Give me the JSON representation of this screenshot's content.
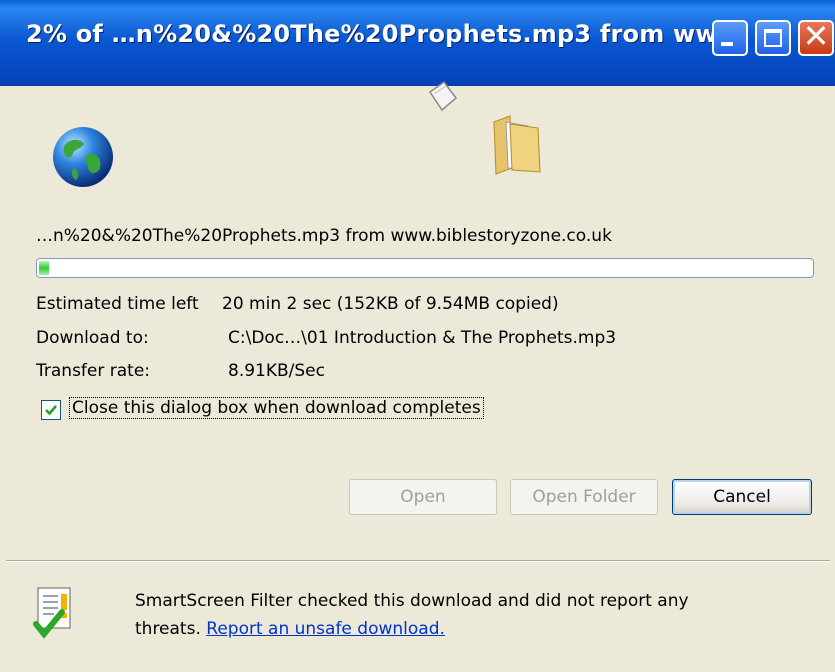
{
  "window": {
    "title": "2% of …n%20&%20The%20Prophets.mp3 from ww…",
    "controls": {
      "close_glyph": "✕"
    }
  },
  "download": {
    "source": "…n%20&%20The%20Prophets.mp3 from www.biblestoryzone.co.uk",
    "progress_percent": 2,
    "estimated_label": "Estimated time left",
    "estimated_value": "20 min 2 sec (152KB of 9.54MB copied)",
    "download_to_label": "Download to:",
    "download_to_value": "C:\\Doc…\\01 Introduction & The Prophets.mp3",
    "rate_label": "Transfer rate:",
    "rate_value": "8.91KB/Sec",
    "close_checkbox_label": "Close this dialog box when download completes",
    "close_checkbox_checked": true
  },
  "buttons": {
    "open": "Open",
    "open_folder": "Open Folder",
    "cancel": "Cancel"
  },
  "smartscreen": {
    "line1": "SmartScreen Filter checked this download and did not report any",
    "line2_prefix": "threats.",
    "link": "Report an unsafe download."
  },
  "colors": {
    "titlebar": "#0a58d2",
    "progress_fill": "#2fcf2f",
    "link": "#0033cc"
  }
}
